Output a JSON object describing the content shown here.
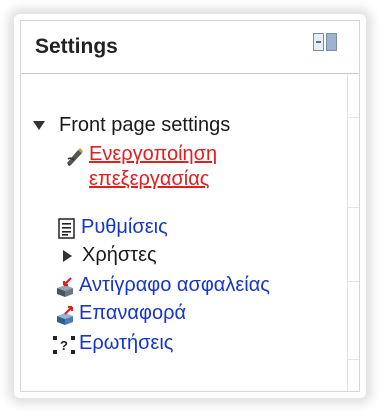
{
  "block": {
    "title": "Settings",
    "dock_icon": "dock-toggle-icon"
  },
  "tree": {
    "front_page": {
      "label": "Front page settings",
      "icon": "expanded-triangle-icon"
    },
    "items": [
      {
        "label": "Ενεργοποίηση επεξεργασίας",
        "icon": "edit-pencil-icon",
        "color": "#e41d1d"
      },
      {
        "label": "Ρυθμίσεις",
        "icon": "settings-document-icon",
        "color": "#1536c8"
      },
      {
        "label": "Χρήστες",
        "icon": "collapsed-triangle-icon",
        "color": "#1a1a1a"
      },
      {
        "label": "Αντίγραφο ασφαλείας",
        "icon": "backup-box-icon",
        "color": "#1536c8"
      },
      {
        "label": "Επαναφορά",
        "icon": "restore-box-icon",
        "color": "#1536c8"
      },
      {
        "label": "Ερωτήσεις",
        "icon": "questions-icon",
        "color": "#1536c8"
      }
    ]
  }
}
